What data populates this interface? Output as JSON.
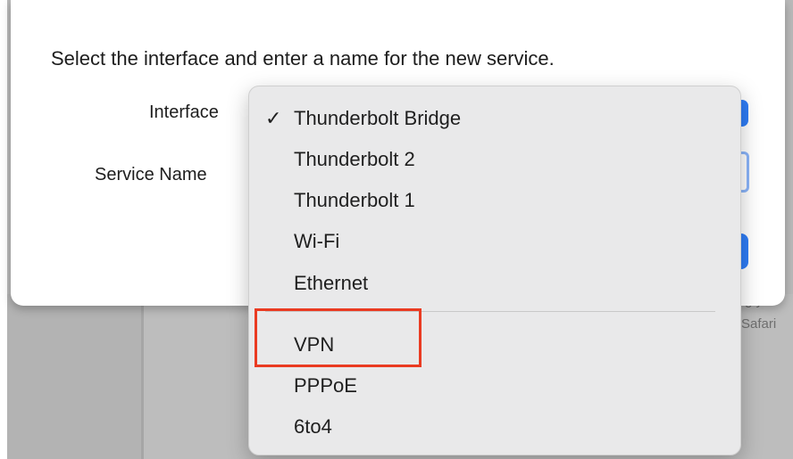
{
  "dialog": {
    "message": "Select the interface and enter a name for the new service.",
    "interface_label": "Interface",
    "service_name_label": "Service Name"
  },
  "menu": {
    "selected": "Thunderbolt Bridge",
    "check_glyph": "✓",
    "items": [
      {
        "label": "Thunderbolt Bridge"
      },
      {
        "label": "Thunderbolt 2"
      },
      {
        "label": "Thunderbolt 1"
      },
      {
        "label": "Wi-Fi"
      },
      {
        "label": "Ethernet"
      },
      {
        "label": "VPN"
      },
      {
        "label": "PPPoE"
      },
      {
        "label": "6to4"
      }
    ]
  },
  "background_window": {
    "peek_line_1": "ıg you",
    "peek_line_2": "Safari"
  },
  "annotation": {
    "highlight_color": "#ea3b22",
    "highlighted_item": "VPN"
  },
  "colors": {
    "accent": "#2f7df6",
    "focus_ring": "#8ab4f8",
    "menu_background": "#e9e9ea"
  }
}
